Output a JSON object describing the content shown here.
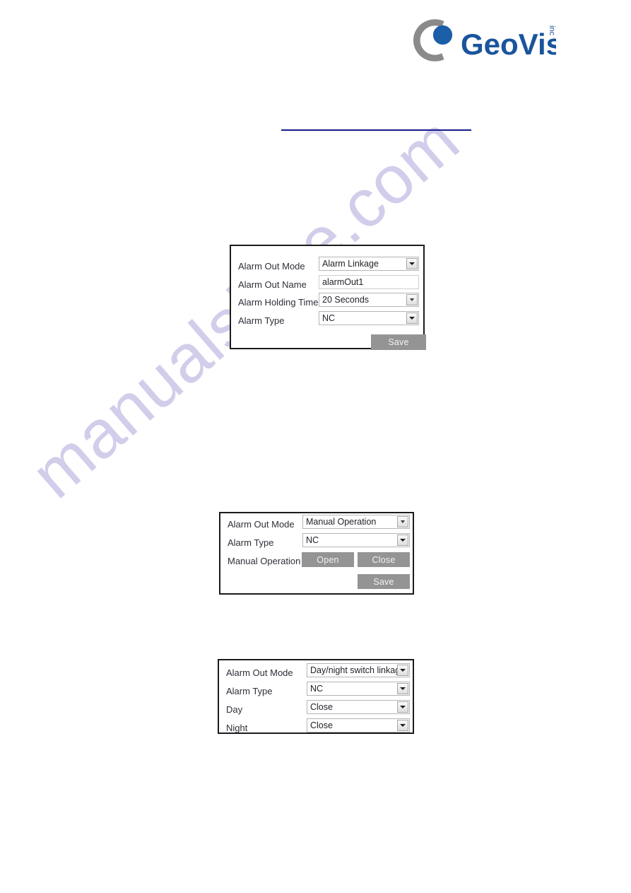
{
  "brand": {
    "name": "GeoVision",
    "suffix": "inc",
    "logo_gray": "#8a8a8a",
    "logo_blue": "#1a5fa8"
  },
  "watermark": {
    "text": "manualshive.com",
    "color": "#cfcbe9"
  },
  "rule": {
    "color": "#1a1a8c"
  },
  "panels": [
    {
      "id": "alarm-linkage-panel",
      "rows": [
        {
          "label": "Alarm Out Mode",
          "control": "select",
          "value": "Alarm Linkage"
        },
        {
          "label": "Alarm Out Name",
          "control": "text",
          "value": "alarmOut1"
        },
        {
          "label": "Alarm Holding Time",
          "control": "select",
          "value": "20 Seconds"
        },
        {
          "label": "Alarm Type",
          "control": "select",
          "value": "NC"
        }
      ],
      "save_label": "Save"
    },
    {
      "id": "manual-operation-panel",
      "rows": [
        {
          "label": "Alarm Out Mode",
          "control": "select",
          "value": "Manual Operation"
        },
        {
          "label": "Alarm Type",
          "control": "select",
          "value": "NC"
        },
        {
          "label": "Manual Operation",
          "control": "buttons",
          "open_label": "Open",
          "close_label": "Close"
        }
      ],
      "save_label": "Save"
    },
    {
      "id": "day-night-linkage-panel",
      "rows": [
        {
          "label": "Alarm Out Mode",
          "control": "select",
          "value": "Day/night switch linkage"
        },
        {
          "label": "Alarm Type",
          "control": "select",
          "value": "NC"
        },
        {
          "label": "Day",
          "control": "select",
          "value": "Close"
        },
        {
          "label": "Night",
          "control": "select",
          "value": "Close"
        }
      ]
    }
  ]
}
